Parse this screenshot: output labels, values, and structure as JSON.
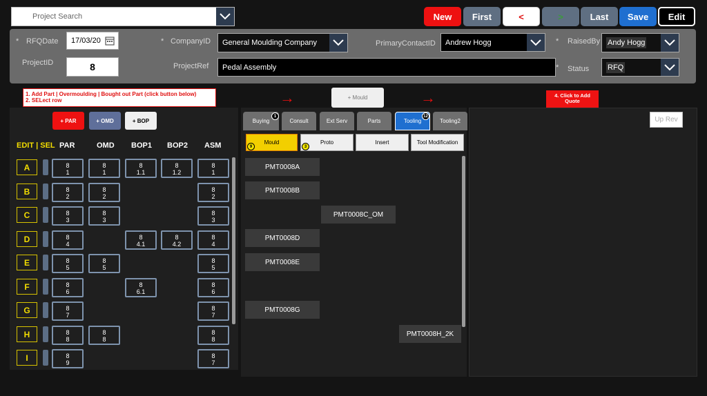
{
  "topbar": {
    "search_placeholder": "Project Search",
    "buttons": {
      "new": "New",
      "first": "First",
      "prev": "<",
      "next": ">",
      "last": "Last",
      "save": "Save",
      "edit": "Edit"
    }
  },
  "header": {
    "rfqdate_label": "RFQDate",
    "rfqdate_value": "17/03/20",
    "projectid_label": "ProjectID",
    "projectid_value": "8",
    "companyid_label": "CompanyID",
    "companyid_value": "General Moulding Company",
    "projectref_label": "ProjectRef",
    "projectref_value": "Pedal Assembly",
    "contact_label": "PrimaryContactID",
    "contact_value": "Andrew Hogg",
    "raisedby_label": "RaisedBy",
    "raisedby_value": "Andy Hogg",
    "status_label": "Status",
    "status_value": "RFQ",
    "required_mark": "*"
  },
  "instructions": {
    "line1": "1. Add Part | Overmoulding | Bought out Part (click button below)",
    "line2": "2. SELect row"
  },
  "add_mould_label": "+ Mould",
  "add_quote_line1": "4. Click to Add",
  "add_quote_line2": "Quote",
  "up_rev_label": "Up Rev",
  "left": {
    "buttons": {
      "par": "+ PAR",
      "omd": "+ OMD",
      "bop": "+ BOP"
    },
    "columns": {
      "edit": "EDIT | SEL",
      "par": "PAR",
      "omd": "OMD",
      "bop1": "BOP1",
      "bop2": "BOP2",
      "asm": "ASM"
    },
    "rows": [
      {
        "label": "A",
        "par": [
          "8",
          "1"
        ],
        "omd": [
          "8",
          "1"
        ],
        "bop1": [
          "8",
          "1.1"
        ],
        "bop2": [
          "8",
          "1.2"
        ],
        "asm": [
          "8",
          "1"
        ]
      },
      {
        "label": "B",
        "par": [
          "8",
          "2"
        ],
        "omd": [
          "8",
          "2"
        ],
        "asm": [
          "8",
          "2"
        ]
      },
      {
        "label": "C",
        "par": [
          "8",
          "3"
        ],
        "omd": [
          "8",
          "3"
        ],
        "asm": [
          "8",
          "3"
        ]
      },
      {
        "label": "D",
        "par": [
          "8",
          "4"
        ],
        "bop1": [
          "8",
          "4.1"
        ],
        "bop2": [
          "8",
          "4.2"
        ],
        "asm": [
          "8",
          "4"
        ]
      },
      {
        "label": "E",
        "par": [
          "8",
          "5"
        ],
        "omd": [
          "8",
          "5"
        ],
        "asm": [
          "8",
          "5"
        ]
      },
      {
        "label": "F",
        "par": [
          "8",
          "6"
        ],
        "bop1": [
          "8",
          "6.1"
        ],
        "asm": [
          "8",
          "6"
        ]
      },
      {
        "label": "G",
        "par": [
          "8",
          "7"
        ],
        "asm": [
          "8",
          "7"
        ]
      },
      {
        "label": "H",
        "par": [
          "8",
          "8"
        ],
        "omd": [
          "8",
          "8"
        ],
        "asm": [
          "8",
          "8"
        ]
      },
      {
        "label": "I",
        "par": [
          "8",
          "9"
        ],
        "asm": [
          "8",
          "7"
        ]
      }
    ]
  },
  "mid": {
    "tabs": [
      "Buying",
      "Consult",
      "Ext Serv",
      "Parts",
      "Tooling",
      "Tooling2"
    ],
    "badges": {
      "buying": "1",
      "tooling": "12"
    },
    "subtabs": [
      "Mould",
      "Proto",
      "Insert",
      "Tool Modification"
    ],
    "subbadges": {
      "mould": "9",
      "proto": "3"
    },
    "items": [
      "PMT0008A",
      "PMT0008B",
      "PMT0008C_OM",
      "PMT0008D",
      "PMT0008E",
      "PMT0008G",
      "PMT0008H_2K"
    ]
  }
}
